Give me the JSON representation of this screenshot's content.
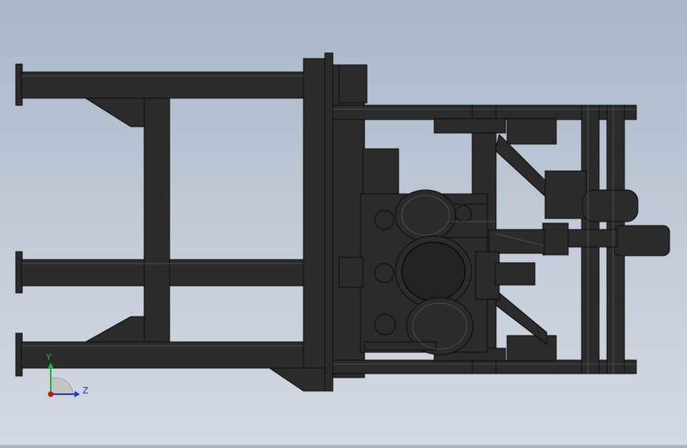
{
  "colors": {
    "background_top": "#a9b6c7",
    "background_bottom": "#d3d9e1",
    "model_dark": "#2a2a2a",
    "model_edge": "#0a0a0a",
    "axis_y": "#1db33a",
    "axis_z": "#2038c8",
    "axis_origin": "#d01010"
  },
  "triad": {
    "y_label": "Y",
    "z_label": "Z"
  }
}
